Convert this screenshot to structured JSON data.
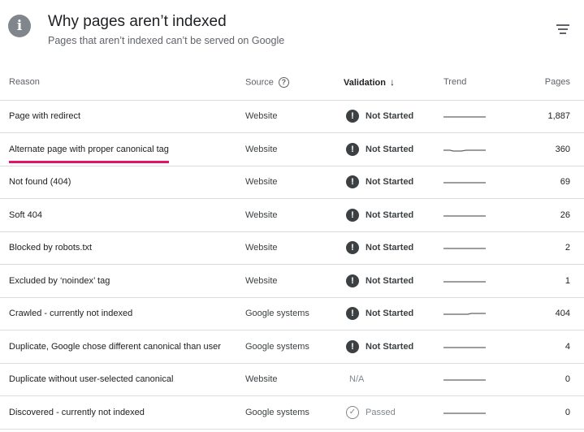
{
  "header": {
    "title": "Why pages aren’t indexed",
    "subtitle": "Pages that aren’t indexed can’t be served on Google"
  },
  "columns": {
    "reason": "Reason",
    "source": "Source",
    "validation": "Validation",
    "trend": "Trend",
    "pages": "Pages"
  },
  "icons": {
    "info": "info-icon",
    "filter": "filter-icon",
    "help": "help-icon",
    "sort": "arrow-down-icon",
    "warning": "exclamation-icon",
    "passed": "check-circle-icon"
  },
  "colors": {
    "highlight": "#e3136c",
    "status_icon": "#3c4043",
    "muted": "#80868b"
  },
  "rows": [
    {
      "reason": "Page with redirect",
      "source": "Website",
      "validation": "Not Started",
      "status": "not_started",
      "pages": "1,887"
    },
    {
      "reason": "Alternate page with proper canonical tag",
      "source": "Website",
      "validation": "Not Started",
      "status": "not_started",
      "pages": "360",
      "highlighted": true
    },
    {
      "reason": "Not found (404)",
      "source": "Website",
      "validation": "Not Started",
      "status": "not_started",
      "pages": "69"
    },
    {
      "reason": "Soft 404",
      "source": "Website",
      "validation": "Not Started",
      "status": "not_started",
      "pages": "26"
    },
    {
      "reason": "Blocked by robots.txt",
      "source": "Website",
      "validation": "Not Started",
      "status": "not_started",
      "pages": "2"
    },
    {
      "reason": "Excluded by ‘noindex’ tag",
      "source": "Website",
      "validation": "Not Started",
      "status": "not_started",
      "pages": "1"
    },
    {
      "reason": "Crawled - currently not indexed",
      "source": "Google systems",
      "validation": "Not Started",
      "status": "not_started",
      "pages": "404"
    },
    {
      "reason": "Duplicate, Google chose different canonical than user",
      "source": "Google systems",
      "validation": "Not Started",
      "status": "not_started",
      "pages": "4"
    },
    {
      "reason": "Duplicate without user-selected canonical",
      "source": "Website",
      "validation": "N/A",
      "status": "na",
      "pages": "0"
    },
    {
      "reason": "Discovered - currently not indexed",
      "source": "Google systems",
      "validation": "Passed",
      "status": "passed",
      "pages": "0"
    }
  ]
}
